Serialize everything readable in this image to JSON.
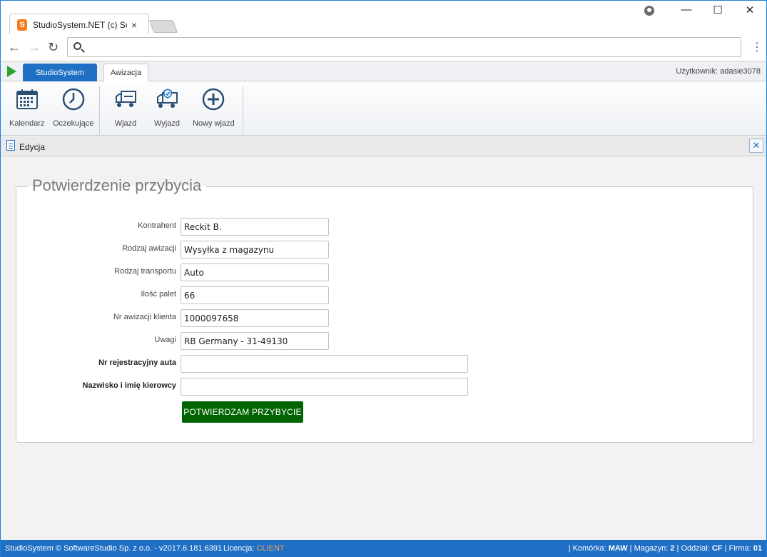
{
  "browser": {
    "tab_title": "StudioSystem.NET (c) Sof",
    "favicon_letter": "S",
    "tab_close": "×",
    "back": "←",
    "forward": "→",
    "reload": "↻",
    "menu": "⋮",
    "window_min": "—",
    "window_max": "☐",
    "window_close": "✕"
  },
  "app_tabs": {
    "primary": "StudioSystem",
    "active": "Awizacja",
    "user": "Użytkownik: adasie3078"
  },
  "ribbon": [
    {
      "label": "Kalendarz",
      "icon": "calendar-icon"
    },
    {
      "label": "Oczekujące",
      "icon": "clock-icon"
    },
    {
      "label": "Wjazd",
      "icon": "truck-in-icon"
    },
    {
      "label": "Wyjazd",
      "icon": "truck-out-icon"
    },
    {
      "label": "Nowy wjazd",
      "icon": "plus-circle-icon"
    }
  ],
  "panel": {
    "title": "Edycja",
    "close": "✕"
  },
  "form": {
    "legend": "Potwierdzenie przybycia",
    "fields": [
      {
        "label": "Kontrahent",
        "value": "Reckit B."
      },
      {
        "label": "Rodzaj awizacji",
        "value": "Wysyłka z magazynu"
      },
      {
        "label": "Rodzaj transportu",
        "value": "Auto"
      },
      {
        "label": "Ilość palet",
        "value": "66"
      },
      {
        "label": "Nr awizacji klienta",
        "value": "1000097658"
      },
      {
        "label": "Uwagi",
        "value": "RB Germany - 31-49130"
      },
      {
        "label": "Nr rejestracyjny auta",
        "value": ""
      },
      {
        "label": "Nazwisko i imię kierowcy",
        "value": ""
      }
    ],
    "submit": "POTWIERDZAM PRZYBYCIE"
  },
  "status": {
    "left": "StudioSystem © SoftwareStudio Sp. z o.o. - v2017.6.181.6391",
    "license_label": "Licencja: ",
    "license_value": "CLIENT",
    "komorka_label": "Komórka: ",
    "komorka": "MAW",
    "magazyn_label": "Magazyn: ",
    "magazyn": "2",
    "oddzial_label": "Oddział: ",
    "oddzial": "CF",
    "firma_label": "Firma: ",
    "firma": "01"
  },
  "colors": {
    "accent": "#1f6fc5",
    "confirm": "#006400",
    "license": "#f6a15c"
  }
}
